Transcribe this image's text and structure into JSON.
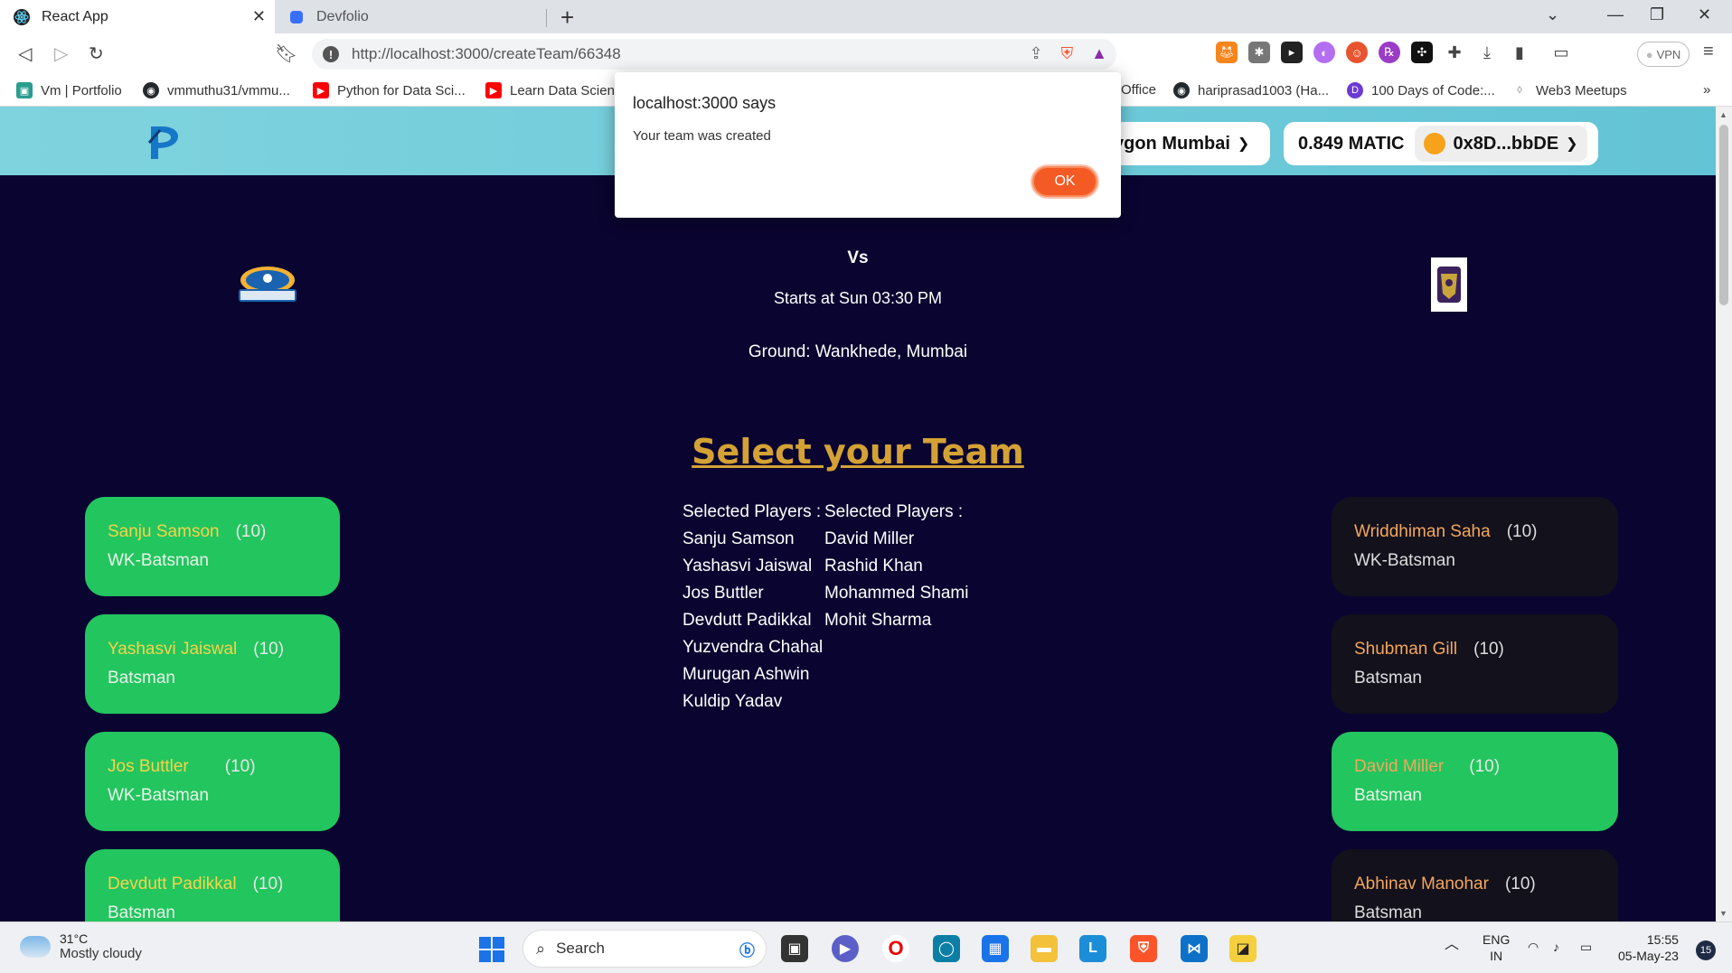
{
  "browser": {
    "tabs": [
      {
        "title": "React App",
        "active": true
      },
      {
        "title": "Devfolio",
        "active": false
      }
    ],
    "url": "http://localhost:3000/createTeam/66348",
    "vpn_label": "VPN",
    "bookmarks": [
      {
        "label": "Vm | Portfolio",
        "icon": "portfolio-icon",
        "color": "#2a9d8f"
      },
      {
        "label": "vmmuthu31/vmmu...",
        "icon": "github-icon",
        "color": "#24292e"
      },
      {
        "label": "Python for Data Sci...",
        "icon": "youtube-icon",
        "color": "#ff0000"
      },
      {
        "label": "Learn Data Scienc",
        "icon": "youtube-icon",
        "color": "#ff0000"
      },
      {
        "label": "Office",
        "icon": "office-icon",
        "color": "#d83b01"
      },
      {
        "label": "hariprasad1003 (Ha...",
        "icon": "github-icon",
        "color": "#24292e"
      },
      {
        "label": "100 Days of Code:...",
        "icon": "devfolio-icon",
        "color": "#6c3bd1"
      },
      {
        "label": "Web3 Meetups",
        "icon": "meetup-icon",
        "color": "#999999"
      }
    ]
  },
  "app": {
    "network_label": "ygon Mumbai",
    "balance": "0.849 MATIC",
    "account": "0x8D...bbDE",
    "match": {
      "vs": "Vs",
      "starts": "Starts at Sun 03:30 PM",
      "ground": "Ground: Wankhede, Mumbai"
    },
    "select_title": "Select your Team",
    "selected_left": {
      "header": "Selected Players :",
      "players": [
        "Sanju Samson",
        "Yashasvi Jaiswal",
        "Jos Buttler",
        "Devdutt Padikkal",
        "Yuzvendra Chahal",
        "Murugan Ashwin",
        "Kuldip Yadav"
      ]
    },
    "selected_right": {
      "header": "Selected Players :",
      "players": [
        "David Miller",
        "Rashid Khan",
        "Mohammed Shami",
        "Mohit Sharma"
      ]
    },
    "left_cards": [
      {
        "name": "Sanju Samson",
        "points": "(10)",
        "role": "WK-Batsman"
      },
      {
        "name": "Yashasvi Jaiswal",
        "points": "(10)",
        "role": "Batsman"
      },
      {
        "name": "Jos Buttler",
        "points": "(10)",
        "role": "WK-Batsman"
      },
      {
        "name": "Devdutt Padikkal",
        "points": "(10)",
        "role": "Batsman"
      }
    ],
    "right_cards": [
      {
        "name": "Wriddhiman Saha",
        "points": "(10)",
        "role": "WK-Batsman",
        "selected": false
      },
      {
        "name": "Shubman Gill",
        "points": "(10)",
        "role": "Batsman",
        "selected": false
      },
      {
        "name": "David Miller",
        "points": "(10)",
        "role": "Batsman",
        "selected": true
      },
      {
        "name": "Abhinav Manohar",
        "points": "(10)",
        "role": "Batsman",
        "selected": false
      }
    ]
  },
  "dialog": {
    "title": "localhost:3000 says",
    "message": "Your team was created",
    "ok_label": "OK"
  },
  "taskbar": {
    "temperature": "31°C",
    "weather": "Mostly cloudy",
    "search_label": "Search",
    "lang_top": "ENG",
    "lang_bottom": "IN",
    "time": "15:55",
    "date": "05-May-23",
    "notifications": "15"
  },
  "colors": {
    "page_bg": "#0a0430",
    "header": "#63c4d6",
    "card_selected": "#22c55e",
    "card_unselected": "#12111c",
    "title_gold": "#d4a234",
    "ok_button": "#f45a24"
  }
}
